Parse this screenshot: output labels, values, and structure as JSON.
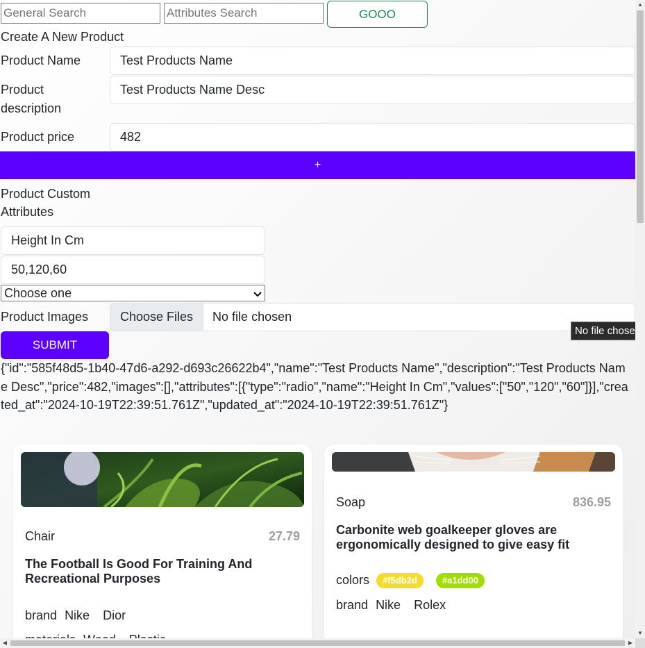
{
  "search": {
    "general_placeholder": "General Search",
    "attributes_placeholder": "Attributes Search",
    "go_label": "GOOO"
  },
  "form": {
    "title": "Create A New Product",
    "name_label": "Product Name",
    "name_value": "Test Products Name",
    "desc_label_1": "Product",
    "desc_label_2": "description",
    "desc_value": "Test Products Name Desc",
    "price_label": "Product price",
    "price_value": "482",
    "add_label": "+",
    "custom_attr_label_1": "Product Custom",
    "custom_attr_label_2": "Attributes",
    "attr_name_value": "Height In Cm",
    "attr_values_value": "50,120,60",
    "attr_type_select": "Choose one",
    "images_label": "Product Images",
    "choose_files_label": "Choose Files",
    "no_file_text": "No file chosen",
    "tooltip_text": "No file chosen",
    "submit_label": "SUBMIT"
  },
  "json_output": "{\"id\":\"585f48d5-1b40-47d6-a292-d693c26622b4\",\"name\":\"Test Products Name\",\"description\":\"Test Products Name Desc\",\"price\":482,\"images\":[],\"attributes\":[{\"type\":\"radio\",\"name\":\"Height In Cm\",\"values\":[\"50\",\"120\",\"60\"]}],\"created_at\":\"2024-10-19T22:39:51.761Z\",\"updated_at\":\"2024-10-19T22:39:51.761Z\"}",
  "products": [
    {
      "category": "Chair",
      "price": "27.79",
      "title": "The Football Is Good For Training And Recreational Purposes",
      "brand_label": "brand",
      "brands": [
        "Nike",
        "Dior"
      ],
      "materials_label": "materials",
      "materials": [
        "Wood",
        "Plastic"
      ]
    },
    {
      "category": "Soap",
      "price": "836.95",
      "title": "Carbonite web goalkeeper gloves are ergonomically designed to give easy fit",
      "colors_label": "colors",
      "colors": [
        {
          "label": "#f5db2d",
          "hex": "#f5db2d"
        },
        {
          "label": "#a1dd00",
          "hex": "#a1dd00"
        }
      ],
      "brand_label": "brand",
      "brands": [
        "Nike",
        "Rolex"
      ]
    }
  ],
  "colors": {
    "accent": "#5c00ff",
    "go_green": "#198754"
  }
}
